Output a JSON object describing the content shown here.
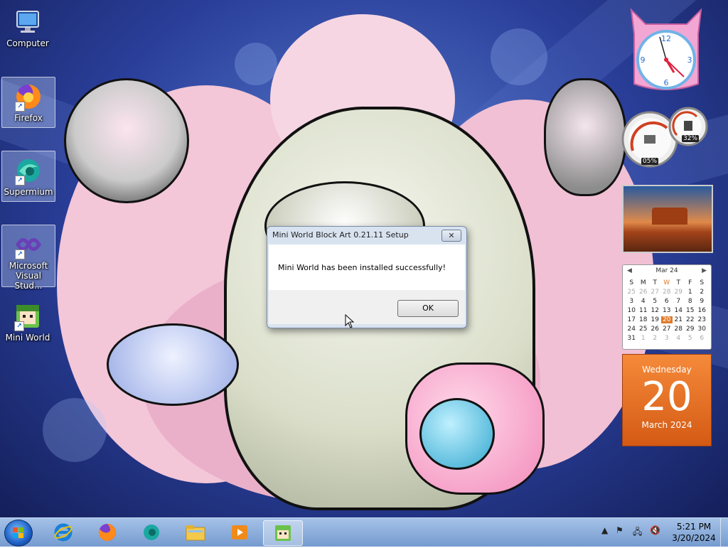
{
  "desktop_icons": [
    {
      "label": "Computer",
      "icon": "computer-icon"
    },
    {
      "label": "Firefox",
      "icon": "firefox-icon"
    },
    {
      "label": "Supermium",
      "icon": "supermium-icon"
    },
    {
      "label": "Microsoft Visual Stud...",
      "icon": "visual-studio-icon"
    },
    {
      "label": "Mini World",
      "icon": "mini-world-icon"
    }
  ],
  "dialog": {
    "title": "Mini World Block Art 0.21.11 Setup",
    "close_label": "✕",
    "message": "Mini World has been installed successfully!",
    "ok_label": "OK"
  },
  "gadgets": {
    "cpu_percent": "05%",
    "memory_percent": "32%",
    "calendar": {
      "month_label": "Mar 24",
      "weekday_headers": [
        "S",
        "M",
        "T",
        "W",
        "T",
        "F",
        "S"
      ],
      "weeks": [
        [
          "25",
          "26",
          "27",
          "28",
          "29",
          "1",
          "2"
        ],
        [
          "3",
          "4",
          "5",
          "6",
          "7",
          "8",
          "9"
        ],
        [
          "10",
          "11",
          "12",
          "13",
          "14",
          "15",
          "16"
        ],
        [
          "17",
          "18",
          "19",
          "20",
          "21",
          "22",
          "23"
        ],
        [
          "24",
          "25",
          "26",
          "27",
          "28",
          "29",
          "30"
        ],
        [
          "31",
          "1",
          "2",
          "3",
          "4",
          "5",
          "6"
        ]
      ],
      "day_name": "Wednesday",
      "day_number": "20",
      "month_year": "March 2024"
    }
  },
  "taskbar": {
    "pinned": [
      {
        "icon": "internet-explorer-icon"
      },
      {
        "icon": "firefox-icon"
      },
      {
        "icon": "supermium-icon"
      },
      {
        "icon": "file-explorer-icon"
      },
      {
        "icon": "media-player-icon"
      },
      {
        "icon": "mini-world-icon"
      }
    ],
    "time": "5:21 PM",
    "date": "3/20/2024",
    "show_hidden_label": "▲"
  },
  "colors": {
    "calendar_accent": "#e07a2a",
    "taskbar": "#8fb0dc"
  }
}
